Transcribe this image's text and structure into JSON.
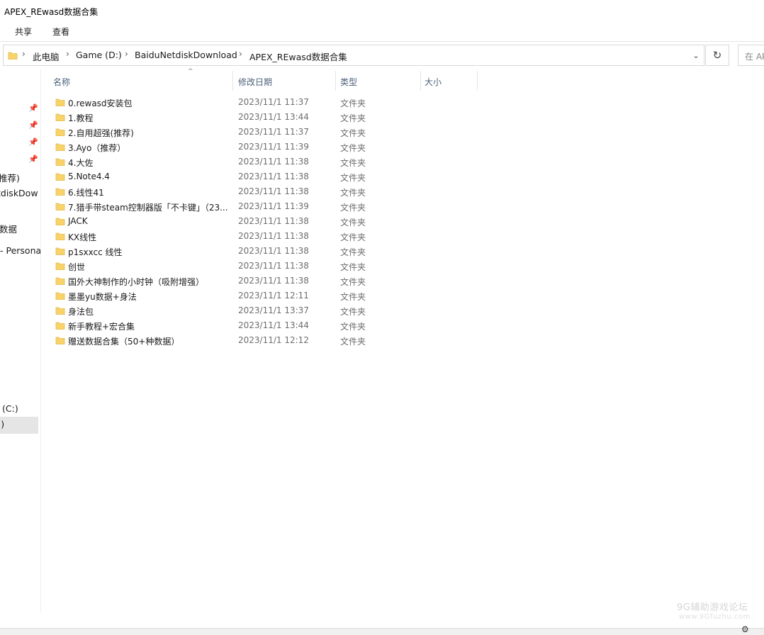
{
  "window": {
    "title": "APEX_REwasd数据合集"
  },
  "ribbon": {
    "tabs": [
      "共享",
      "查看"
    ]
  },
  "address": {
    "crumbs": [
      "此电脑",
      "Game (D:)",
      "BaiduNetdiskDownload",
      "APEX_REwasd数据合集"
    ],
    "search_placeholder": "在 AP"
  },
  "nav": {
    "items": [
      "推荐)",
      "tdiskDow",
      "数据",
      "- Persona",
      "(C:)",
      ":)"
    ]
  },
  "columns": {
    "name": "名称",
    "date": "修改日期",
    "type": "类型",
    "size": "大小"
  },
  "files": [
    {
      "name": "0.rewasd安装包",
      "date": "2023/11/1 11:37",
      "type": "文件夹"
    },
    {
      "name": "1.教程",
      "date": "2023/11/1 13:44",
      "type": "文件夹"
    },
    {
      "name": "2.自用超强(推荐)",
      "date": "2023/11/1 11:37",
      "type": "文件夹"
    },
    {
      "name": "3.Ayo（推荐）",
      "date": "2023/11/1 11:39",
      "type": "文件夹"
    },
    {
      "name": "4.大佐",
      "date": "2023/11/1 11:38",
      "type": "文件夹"
    },
    {
      "name": "5.Note4.4",
      "date": "2023/11/1 11:38",
      "type": "文件夹"
    },
    {
      "name": "6.线性41",
      "date": "2023/11/1 11:38",
      "type": "文件夹"
    },
    {
      "name": "7.猎手带steam控制器版「不卡键」（23...",
      "date": "2023/11/1 11:39",
      "type": "文件夹"
    },
    {
      "name": "JACK",
      "date": "2023/11/1 11:38",
      "type": "文件夹"
    },
    {
      "name": "KX线性",
      "date": "2023/11/1 11:38",
      "type": "文件夹"
    },
    {
      "name": "p1sxxcc 线性",
      "date": "2023/11/1 11:38",
      "type": "文件夹"
    },
    {
      "name": "创世",
      "date": "2023/11/1 11:38",
      "type": "文件夹"
    },
    {
      "name": "国外大神制作的小时钟（吸附增强）",
      "date": "2023/11/1 11:38",
      "type": "文件夹"
    },
    {
      "name": "墨墨yu数据+身法",
      "date": "2023/11/1 12:11",
      "type": "文件夹"
    },
    {
      "name": "身法包",
      "date": "2023/11/1 13:37",
      "type": "文件夹"
    },
    {
      "name": "新手教程+宏合集",
      "date": "2023/11/1 13:44",
      "type": "文件夹"
    },
    {
      "name": "赠送数据合集（50+种数据）",
      "date": "2023/11/1 12:12",
      "type": "文件夹"
    }
  ],
  "watermark": {
    "line1": "9G辅助游戏论坛",
    "line2": "www.9Gfuzhu.com"
  },
  "colors": {
    "folder": "#f7d36a",
    "folder_dark": "#e6b94a",
    "header_text": "#4c607a",
    "selected": "#e5e5e5"
  }
}
